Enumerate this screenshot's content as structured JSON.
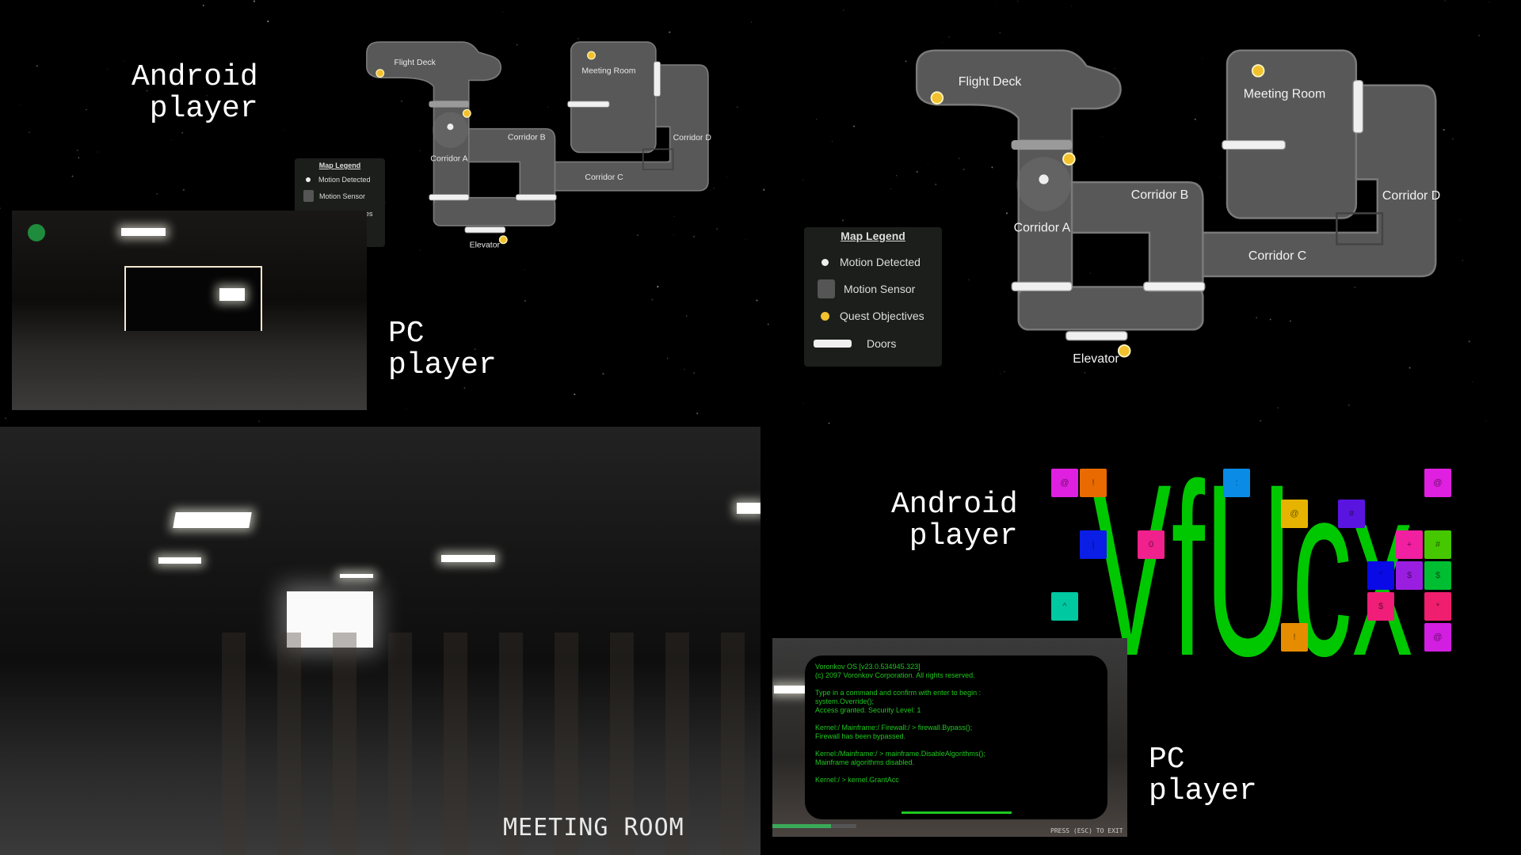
{
  "labels": {
    "android_top": "Android\n player",
    "pc_top": "PC\nplayer",
    "android_bottom": "Android\n player",
    "pc_bottom": "PC\nplayer"
  },
  "map": {
    "rooms": {
      "flight_deck": "Flight Deck",
      "meeting_room": "Meeting Room",
      "corridor_a": "Corridor A",
      "corridor_b": "Corridor B",
      "corridor_c": "Corridor C",
      "corridor_d": "Corridor D",
      "elevator": "Elevator"
    },
    "legend": {
      "title": "Map Legend",
      "motion_detected": "Motion Detected",
      "motion_sensor": "Motion Sensor",
      "quest_objectives": "Quest Objectives",
      "doors": "Doors"
    },
    "colors": {
      "floor": "#585858",
      "objective": "#f2c12e",
      "door": "#f0f0f0"
    }
  },
  "scene": {
    "title": "MEETING ROOM"
  },
  "terminal": {
    "lines": "Voronkov OS [v23.0.534945.323]\n(c) 2097 Voronkov Corporation. All rights reserved.\n\nType in a command and confirm with enter to begin :\nsystem.Override();\nAccess granted. Security Level: 1\n\nKernel:/ Mainframe:/ Firewall:/ > firewall.Bypass();\nFirewall has been bypassed.\n\nKernel:/Mainframe:/ > mainframe.DisableAlgorithms();\nMainframe algorithms disabled.\n\nKernel:/ > kernel.GrantAcc",
    "press_exit": "PRESS (ESC) TO EXIT",
    "text_color": "#1fc81f"
  },
  "code_puzzle": {
    "code": "VfUcx",
    "code_color": "#00c800",
    "tiles": [
      {
        "char": "@",
        "color": "#e020e0"
      },
      {
        "char": "!",
        "color": "#e86a00"
      },
      {
        "char": ":",
        "color": "#0a8ce6"
      },
      {
        "char": "@",
        "color": "#e020e0"
      },
      {
        "char": "@",
        "color": "#e6b400"
      },
      {
        "char": "#",
        "color": "#5a14e0"
      },
      {
        "char": "|",
        "color": "#0a1ee6"
      },
      {
        "char": "0",
        "color": "#f0208c"
      },
      {
        "char": "+",
        "color": "#f020a0"
      },
      {
        "char": "#",
        "color": "#46c800"
      },
      {
        "char": "\"",
        "color": "#0a0ae6"
      },
      {
        "char": "$",
        "color": "#9a1ee0"
      },
      {
        "char": "$",
        "color": "#00be32"
      },
      {
        "char": "^",
        "color": "#00c8a0"
      },
      {
        "char": "$",
        "color": "#f01e78"
      },
      {
        "char": "*",
        "color": "#f01e6e"
      },
      {
        "char": "!",
        "color": "#e68c00"
      },
      {
        "char": "@",
        "color": "#d21ee0"
      }
    ]
  }
}
